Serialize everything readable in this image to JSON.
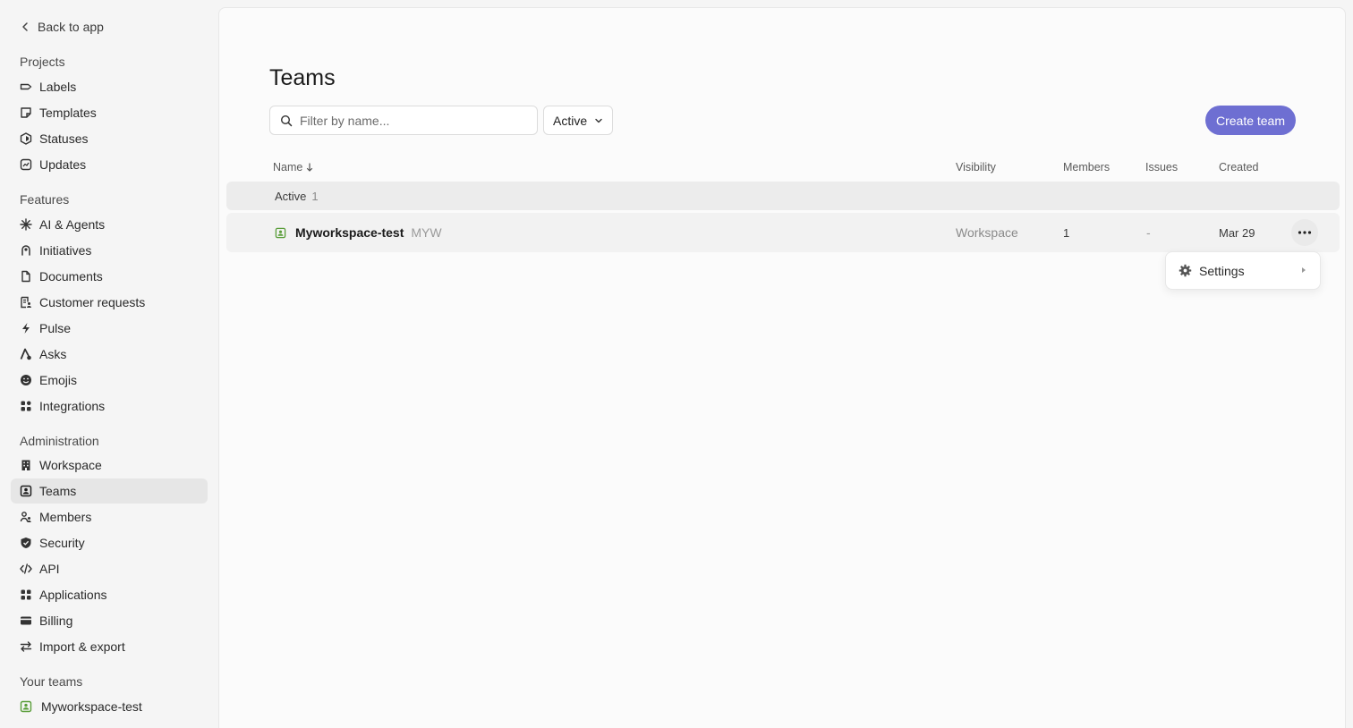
{
  "sidebar": {
    "back_label": "Back to app",
    "sections": {
      "projects": "Projects",
      "features": "Features",
      "administration": "Administration",
      "your_teams": "Your teams"
    },
    "projects": [
      {
        "label": "Labels",
        "icon": "label-icon"
      },
      {
        "label": "Templates",
        "icon": "template-icon"
      },
      {
        "label": "Statuses",
        "icon": "status-icon"
      },
      {
        "label": "Updates",
        "icon": "updates-icon"
      }
    ],
    "features": [
      {
        "label": "AI & Agents",
        "icon": "sparkle-icon"
      },
      {
        "label": "Initiatives",
        "icon": "initiative-icon"
      },
      {
        "label": "Documents",
        "icon": "document-icon"
      },
      {
        "label": "Customer requests",
        "icon": "customer-request-icon"
      },
      {
        "label": "Pulse",
        "icon": "pulse-icon"
      },
      {
        "label": "Asks",
        "icon": "asks-icon"
      },
      {
        "label": "Emojis",
        "icon": "emoji-icon"
      },
      {
        "label": "Integrations",
        "icon": "integrations-icon"
      }
    ],
    "administration": [
      {
        "label": "Workspace",
        "icon": "building-icon"
      },
      {
        "label": "Teams",
        "icon": "team-icon"
      },
      {
        "label": "Members",
        "icon": "members-icon"
      },
      {
        "label": "Security",
        "icon": "shield-icon"
      },
      {
        "label": "API",
        "icon": "code-icon"
      },
      {
        "label": "Applications",
        "icon": "applications-icon"
      },
      {
        "label": "Billing",
        "icon": "credit-card-icon"
      },
      {
        "label": "Import & export",
        "icon": "import-export-icon"
      }
    ],
    "active_item": "Teams",
    "your_teams": [
      {
        "label": "Myworkspace-test",
        "icon": "team-icon"
      }
    ]
  },
  "main": {
    "title": "Teams",
    "search": {
      "placeholder": "Filter by name..."
    },
    "status_filter": {
      "value": "Active"
    },
    "create_button": "Create team",
    "columns": {
      "name": "Name",
      "visibility": "Visibility",
      "members": "Members",
      "issues": "Issues",
      "created": "Created"
    },
    "group": {
      "label": "Active",
      "count": "1"
    },
    "rows": [
      {
        "name": "Myworkspace-test",
        "key": "MYW",
        "visibility": "Workspace",
        "members": "1",
        "issues": "-",
        "created": "Mar 29"
      }
    ],
    "context_menu": {
      "items": [
        {
          "label": "Settings"
        }
      ]
    }
  },
  "colors": {
    "accent": "#6e6fd2",
    "team_icon": "#5a9e3a",
    "sidebar_bg": "#f5f5f5",
    "main_bg": "#fbfbfb"
  }
}
